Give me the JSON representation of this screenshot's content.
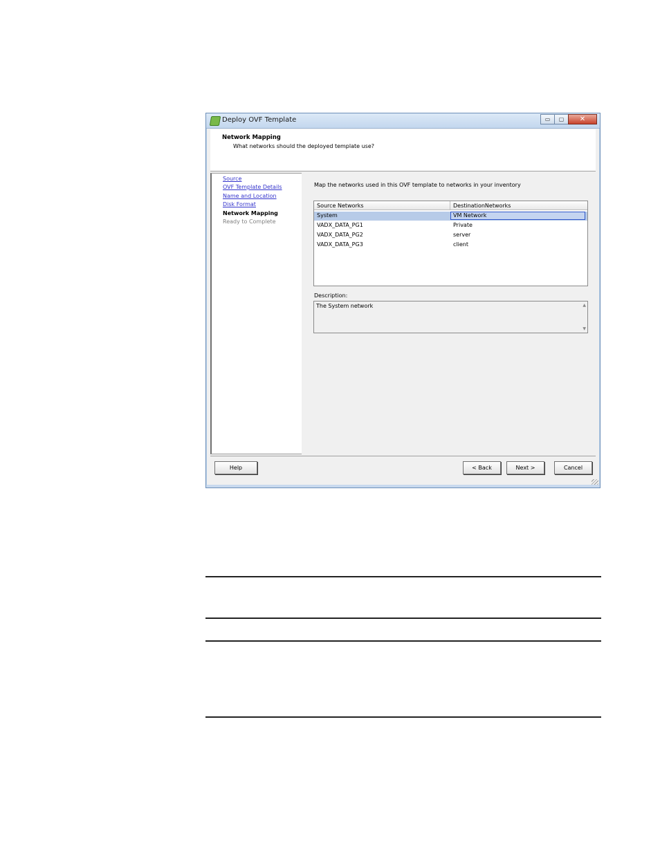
{
  "window": {
    "title": "Deploy OVF Template",
    "minimize_glyph": "▭",
    "restore_glyph": "▢",
    "close_glyph": "✕"
  },
  "header": {
    "title": "Network Mapping",
    "subtitle": "What networks should the deployed template use?"
  },
  "sidebar": {
    "items": [
      {
        "label": "Source",
        "state": "link"
      },
      {
        "label": "OVF Template Details",
        "state": "link"
      },
      {
        "label": "Name and Location",
        "state": "link"
      },
      {
        "label": "Disk Format",
        "state": "link"
      },
      {
        "label": "Network Mapping",
        "state": "active"
      },
      {
        "label": "Ready to Complete",
        "state": "disabled"
      }
    ]
  },
  "main": {
    "instruction": "Map the networks used in this OVF template to networks in your inventory",
    "table": {
      "headers": [
        "Source Networks",
        "DestinationNetworks"
      ],
      "rows": [
        [
          "System",
          "VM Network"
        ],
        [
          "VADX_DATA_PG1",
          "Private"
        ],
        [
          "VADX_DATA_PG2",
          "server"
        ],
        [
          "VADX_DATA_PG3",
          "client"
        ]
      ]
    },
    "description_label": "Description:",
    "description_text": "The System network"
  },
  "buttons": {
    "help": "Help",
    "back": "< Back",
    "next": "Next >",
    "cancel": "Cancel"
  },
  "colors": {
    "link": "#3333cc",
    "selection": "#b7cbe8",
    "titlebar": "#c3d7ee"
  }
}
